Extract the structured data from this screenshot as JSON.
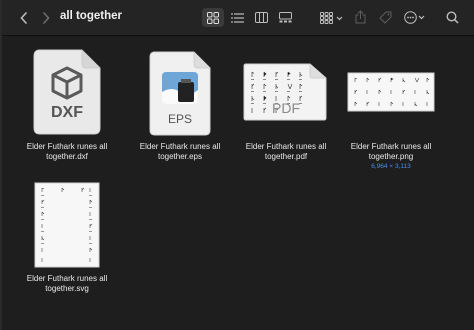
{
  "toolbar": {
    "title": "all together",
    "back_icon": "chevron-left-icon",
    "forward_icon": "chevron-right-icon",
    "views": [
      "icon-view-icon",
      "list-view-icon",
      "column-view-icon",
      "gallery-view-icon"
    ],
    "active_view": "icon-view-icon"
  },
  "files": [
    {
      "name": "Elder Futhark runes all\ntogether.dxf",
      "type_label": "DXF"
    },
    {
      "name": "Elder Futhark runes all\ntogether.eps",
      "type_label": "EPS"
    },
    {
      "name": "Elder Futhark runes all\ntogether.pdf",
      "type_label": "PDF"
    },
    {
      "name": "Elder Futhark runes all\ntogether.png",
      "dimensions": "6,964 × 3,113"
    },
    {
      "name": "Elder Futhark runes all\ntogether.svg"
    }
  ],
  "colors": {
    "accent": "#4b8fe8",
    "background": "#1e1e1e",
    "toolbar": "#242424"
  }
}
